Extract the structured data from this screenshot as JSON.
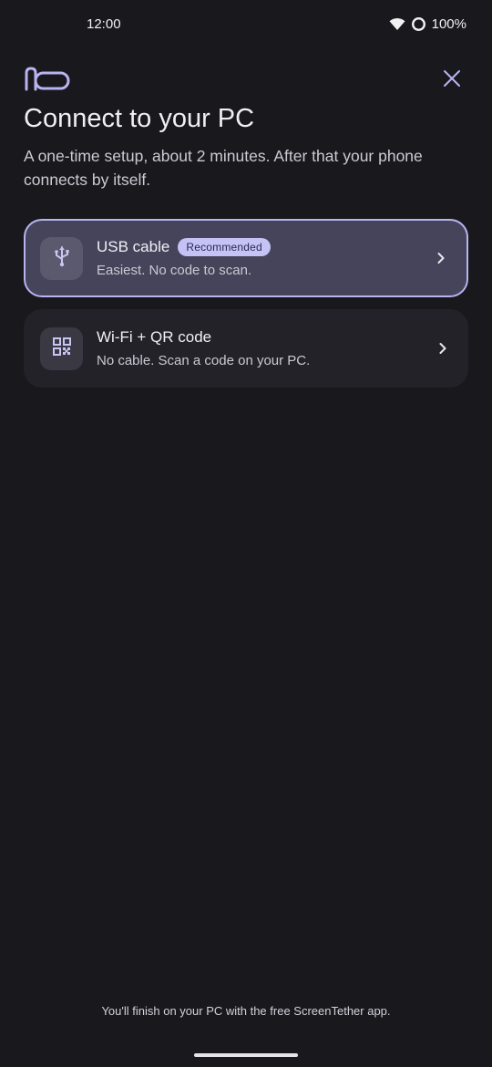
{
  "status_bar": {
    "time": "12:00",
    "battery": "100%"
  },
  "header": {
    "logo_icon": "cable-loop-icon",
    "close_icon": "close-icon"
  },
  "title": "Connect to your PC",
  "subtitle": "A one-time setup, about 2 minutes. After that your phone connects by itself.",
  "options": [
    {
      "icon": "usb-icon",
      "title": "USB cable",
      "badge": "Recommended",
      "description": "Easiest. No code to scan.",
      "selected": true
    },
    {
      "icon": "qr-code-icon",
      "title": "Wi-Fi + QR code",
      "description": "No cable. Scan a code on your PC.",
      "selected": false
    }
  ],
  "footer_note": "You'll finish on your PC with the free ScreenTether app.",
  "colors": {
    "background": "#19181d",
    "accent": "#b8b4f0",
    "badge_bg": "#c5c2f6",
    "selected_card": "#46445a",
    "card": "#232229"
  }
}
